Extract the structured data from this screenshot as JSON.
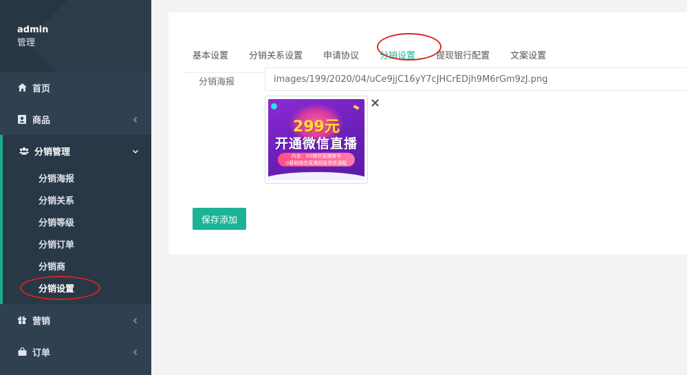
{
  "sidebar": {
    "user": "admin",
    "role": "管理",
    "items": [
      {
        "label": "首页"
      },
      {
        "label": "商品"
      },
      {
        "label": "分销管理"
      },
      {
        "label": "营销"
      },
      {
        "label": "订单"
      }
    ],
    "sub_items": [
      {
        "label": "分销海报"
      },
      {
        "label": "分销关系"
      },
      {
        "label": "分销等级"
      },
      {
        "label": "分销订单"
      },
      {
        "label": "分销商"
      },
      {
        "label": "分销设置"
      }
    ]
  },
  "tabs": [
    {
      "label": "基本设置"
    },
    {
      "label": "分销关系设置"
    },
    {
      "label": "申请协议"
    },
    {
      "label": "分销设置"
    },
    {
      "label": "提现银行配置"
    },
    {
      "label": "文案设置"
    }
  ],
  "form": {
    "poster_label": "分销海报",
    "poster_path": "images/199/2020/04/uCe9jjC16yY7cJHCrEDjh9M6rGm9zJ.png",
    "save_label": "保存添加"
  },
  "poster_image": {
    "price": "299元",
    "headline": "开通微信直播",
    "band_line1": "内含：5G微信直播账号",
    "band_line2": "0基础微信直播超级带货课程"
  },
  "colors": {
    "sidebar_bg": "#2f4050",
    "accent": "#1ab394",
    "annotation": "#d9251d"
  }
}
